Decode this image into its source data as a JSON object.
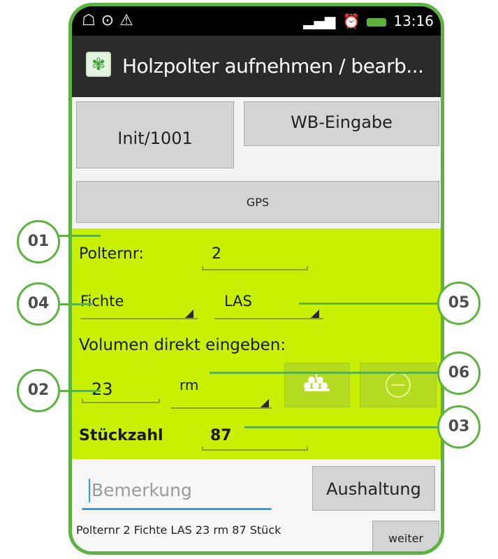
{
  "status_bar": {
    "time": "13:16"
  },
  "title_bar": {
    "title": "Holzpolter aufnehmen / bearb..."
  },
  "buttons": {
    "init": "Init/1001",
    "wb_eingabe": "WB-Eingabe",
    "gps": "GPS",
    "aushaltung": "Aushaltung",
    "weiter": "weiter"
  },
  "form": {
    "polternr_label": "Polternr:",
    "polternr_value": "2",
    "species_value": "Fichte",
    "grade_value": "LAS",
    "volume_label": "Volumen direkt eingeben:",
    "volume_value": "23",
    "unit_value": "rm",
    "count_label": "Stückzahl",
    "count_value": "87"
  },
  "remark": {
    "placeholder": "Bemerkung"
  },
  "summary": "Polternr  2 Fichte LAS 23 rm 87 Stück",
  "callouts": {
    "c01": "01",
    "c02": "02",
    "c03": "03",
    "c04": "04",
    "c05": "05",
    "c06": "06"
  },
  "colors": {
    "accent_green": "#5db33f",
    "form_background": "#c9ef03",
    "focus_blue": "#2e9fd8"
  },
  "icons": {
    "app": "holz-app-icon",
    "calc_1": "log-stack-icon",
    "calc_2": "round-log-icon"
  }
}
